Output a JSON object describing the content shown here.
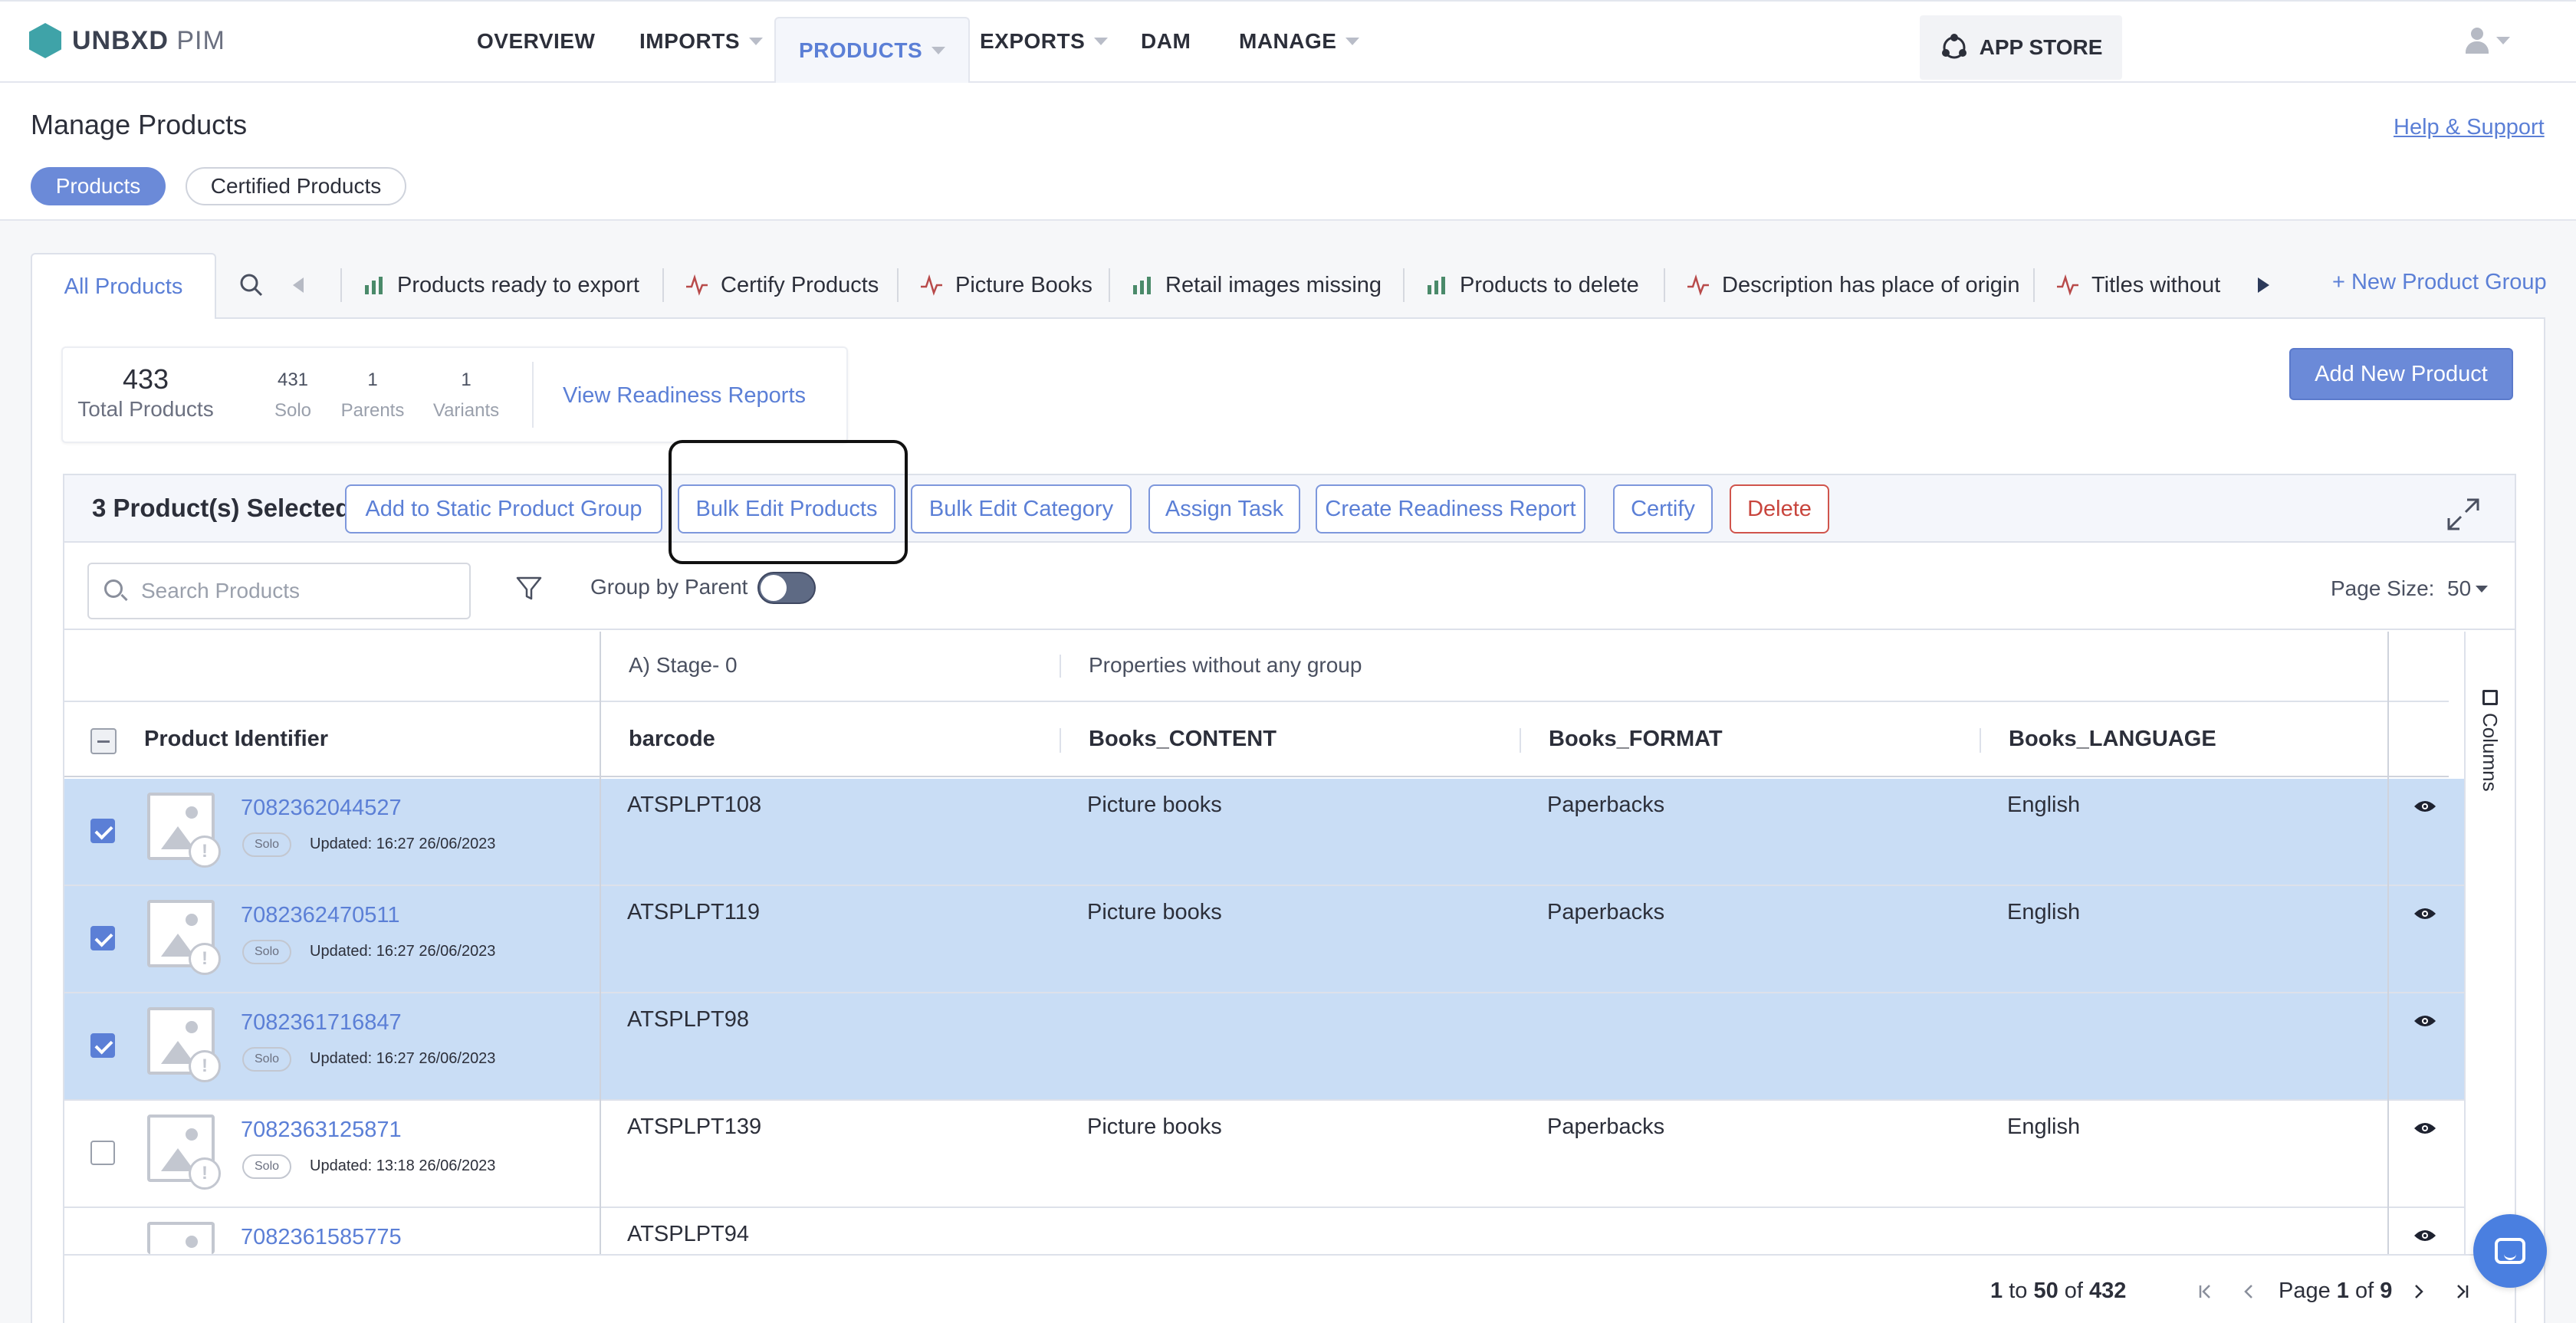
{
  "app": {
    "brand": "UNBXD",
    "brand_suffix": "PIM"
  },
  "nav": {
    "items": [
      {
        "label": "OVERVIEW"
      },
      {
        "label": "IMPORTS"
      },
      {
        "label": "PRODUCTS"
      },
      {
        "label": "EXPORTS"
      },
      {
        "label": "DAM"
      },
      {
        "label": "MANAGE"
      }
    ],
    "active": "PRODUCTS",
    "app_store": "APP STORE"
  },
  "header": {
    "title": "Manage Products",
    "help": "Help & Support",
    "pills": [
      "Products",
      "Certified Products"
    ]
  },
  "group_tabs": {
    "all": "All Products",
    "items": [
      {
        "label": "Products ready to export",
        "icon": "bar-chart-icon"
      },
      {
        "label": "Certify Products",
        "icon": "pulse-icon"
      },
      {
        "label": "Picture Books",
        "icon": "pulse-icon"
      },
      {
        "label": "Retail images missing",
        "icon": "bar-chart-icon"
      },
      {
        "label": "Products to delete",
        "icon": "bar-chart-icon"
      },
      {
        "label": "Description has place of origin",
        "icon": "pulse-icon"
      },
      {
        "label": "Titles without",
        "icon": "pulse-icon"
      }
    ],
    "new_group": "+ New Product Group"
  },
  "stats": {
    "total": "433",
    "total_label": "Total Products",
    "solo": "431",
    "solo_label": "Solo",
    "parents": "1",
    "parents_label": "Parents",
    "variants": "1",
    "variants_label": "Variants",
    "readiness_link": "View Readiness Reports"
  },
  "add_new": "Add New Product",
  "selection": {
    "count_text": "3 Product(s) Selected",
    "actions": [
      "Add to Static Product Group",
      "Bulk Edit Products",
      "Bulk Edit Category",
      "Assign Task",
      "Create Readiness Report",
      "Certify",
      "Delete"
    ]
  },
  "toolbar": {
    "search_placeholder": "Search Products",
    "group_by_parent": "Group by Parent",
    "page_size_label": "Page Size:",
    "page_size": "50"
  },
  "table": {
    "group_headers": [
      "A) Stage- 0",
      "Properties without any group"
    ],
    "columns": [
      "Product Identifier",
      "barcode",
      "Books_CONTENT",
      "Books_FORMAT",
      "Books_LANGUAGE"
    ],
    "columns_toggle": "Columns",
    "rows": [
      {
        "id": "7082362044527",
        "type": "Solo",
        "updated": "Updated: 16:27 26/06/2023",
        "barcode": "ATSPLPT108",
        "content": "Picture books",
        "format": "Paperbacks",
        "language": "English",
        "selected": true
      },
      {
        "id": "7082362470511",
        "type": "Solo",
        "updated": "Updated: 16:27 26/06/2023",
        "barcode": "ATSPLPT119",
        "content": "Picture books",
        "format": "Paperbacks",
        "language": "English",
        "selected": true
      },
      {
        "id": "7082361716847",
        "type": "Solo",
        "updated": "Updated: 16:27 26/06/2023",
        "barcode": "ATSPLPT98",
        "content": "",
        "format": "",
        "language": "",
        "selected": true
      },
      {
        "id": "7082363125871",
        "type": "Solo",
        "updated": "Updated: 13:18 26/06/2023",
        "barcode": "ATSPLPT139",
        "content": "Picture books",
        "format": "Paperbacks",
        "language": "English",
        "selected": false
      },
      {
        "id": "7082361585775",
        "type": "",
        "updated": "",
        "barcode": "ATSPLPT94",
        "content": "",
        "format": "",
        "language": "",
        "selected": false
      }
    ]
  },
  "pagination": {
    "from": "1",
    "to": "50",
    "of": "432",
    "to_word": "to",
    "of_word": "of",
    "page_word": "Page",
    "page": "1",
    "page_of_word": "of",
    "pages": "9"
  },
  "colors": {
    "accent": "#5b7fd6",
    "selected_row": "#c9ddf5",
    "danger": "#c8453d",
    "brand": "#3fa3a8"
  }
}
